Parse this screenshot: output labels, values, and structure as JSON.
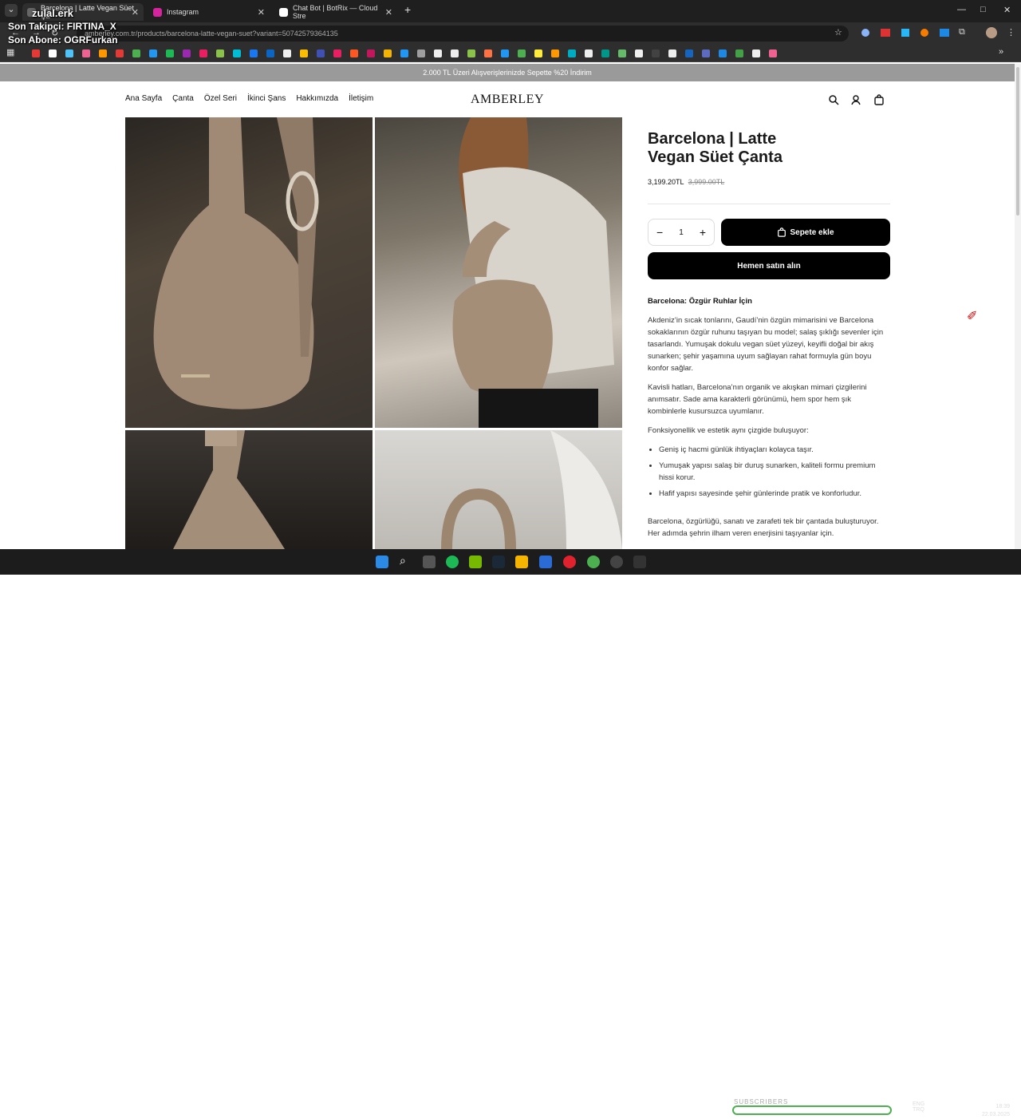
{
  "browser": {
    "tabs": [
      {
        "title": "Barcelona | Latte Vegan Süet Ça",
        "icon": "site-favicon",
        "color": "#666666"
      },
      {
        "title": "Instagram",
        "icon": "instagram-favicon",
        "color": "#d6249f"
      },
      {
        "title": "Chat Bot | BotRix — Cloud Stre",
        "icon": "botrix-favicon",
        "color": "#ffffff"
      }
    ],
    "url": "amberley.com.tr/products/barcelona-latte-vegan-suet?variant=50742579364135"
  },
  "stream_overlay": {
    "channel": "zulal.erk",
    "last_follower": "Son Takipçi: FIRTINA_X",
    "last_subscriber": "Son Abone: OGRFurkan"
  },
  "site": {
    "announcement": "2.000 TL Üzeri Alışverişlerinizde Sepette %20 İndirim",
    "logo": "AMBERLEY",
    "nav": [
      "Ana Sayfa",
      "Çanta",
      "Özel Seri",
      "İkinci Şans",
      "Hakkımızda",
      "İletişim"
    ]
  },
  "product": {
    "title": "Barcelona | Latte Vegan Süet Çanta",
    "price": "3,199.20TL",
    "old_price": "3,999.00TL",
    "quantity": "1",
    "add_to_cart": "Sepete ekle",
    "buy_now": "Hemen satın alın",
    "description": {
      "heading": "Barcelona: Özgür Ruhlar İçin",
      "p1": "Akdeniz’in sıcak tonlarını, Gaudí’nin özgün mimarisini ve Barcelona sokaklarının özgür ruhunu taşıyan bu model; salaş şıklığı sevenler için tasarlandı. Yumuşak dokulu vegan süet yüzeyi, keyifli doğal bir akış sunarken; şehir yaşamına uyum sağlayan rahat formuyla gün boyu konfor sağlar.",
      "p2": "Kavisli hatları, Barcelona’nın organik ve akışkan mimari çizgilerini anımsatır. Sade ama karakterli görünümü, hem spor hem şık kombinlerle kusursuzca uyumlanır.",
      "p3": "Fonksiyonellik ve estetik aynı çizgide buluşuyor:",
      "bullets": [
        "Geniş iç hacmi günlük ihtiyaçları kolayca taşır.",
        "Yumuşak yapısı salaş bir duruş sunarken, kaliteli formu premium hissi korur.",
        "Hafif yapısı sayesinde şehir günlerinde pratik ve konforludur."
      ],
      "p4": "Barcelona, özgürlüğü, sanatı ve zarafeti tek bir çantada buluşturuyor. Her adımda şehrin ilham veren enerjisini taşıyanlar için."
    }
  },
  "taskbar": {
    "subscribers_label": "SUBSCRIBERS",
    "lang": "ENG",
    "region": "TRQ",
    "time": "18:39",
    "date": "22.03.2025"
  }
}
